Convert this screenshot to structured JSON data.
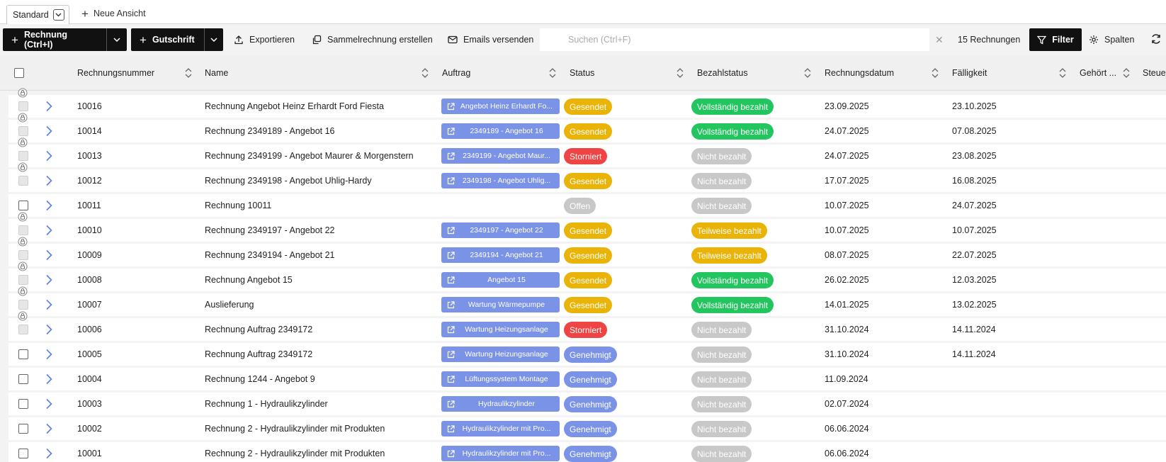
{
  "tabs": {
    "active": "Standard",
    "new_view": "Neue Ansicht"
  },
  "toolbar": {
    "invoice_button": "Rechnung (Ctrl+I)",
    "credit_button": "Gutschrift",
    "export": "Exportieren",
    "collective": "Sammelrechnung erstellen",
    "emails": "Emails versenden",
    "search_placeholder": "Suchen (Ctrl+F)",
    "search_value": "",
    "count": "15 Rechnungen",
    "filter": "Filter",
    "columns": "Spalten"
  },
  "columns": {
    "number": "Rechnungsnummer",
    "name": "Name",
    "order": "Auftrag",
    "status": "Status",
    "payment": "Bezahlstatus",
    "date": "Rechnungsdatum",
    "due": "Fälligkeit",
    "owner": "Gehört ...",
    "tax": "Steue"
  },
  "colors": {
    "sent": "#eab308",
    "cancelled": "#ef4444",
    "open": "#c8c8c8",
    "approved": "#7b93e6",
    "paid_full": "#22c55e",
    "paid_none": "#c8c8c8",
    "paid_partial": "#eab308",
    "order_link": "#7b93e6"
  },
  "rows": [
    {
      "number": "10016",
      "name": "Rechnung Angebot Heinz Erhardt Ford Fiesta",
      "order": "Angebot Heinz Erhardt Fo...",
      "status": "Gesendet",
      "status_type": "sent",
      "payment": "Vollständig bezahlt",
      "payment_type": "full",
      "date": "23.09.2025",
      "due": "23.10.2025",
      "locked": true
    },
    {
      "number": "10014",
      "name": "Rechnung 2349189 - Angebot 16",
      "order": "2349189 - Angebot 16",
      "status": "Gesendet",
      "status_type": "sent",
      "payment": "Vollständig bezahlt",
      "payment_type": "full",
      "date": "24.07.2025",
      "due": "07.08.2025",
      "locked": true
    },
    {
      "number": "10013",
      "name": "Rechnung 2349199 - Angebot Maurer & Morgenstern",
      "order": "2349199 - Angebot Maur...",
      "status": "Storniert",
      "status_type": "cancel",
      "payment": "Nicht bezahlt",
      "payment_type": "none",
      "date": "24.07.2025",
      "due": "23.08.2025",
      "locked": true
    },
    {
      "number": "10012",
      "name": "Rechnung 2349198 - Angebot Uhlig-Hardy",
      "order": "2349198 - Angebot Uhlig...",
      "status": "Gesendet",
      "status_type": "sent",
      "payment": "Nicht bezahlt",
      "payment_type": "none",
      "date": "17.07.2025",
      "due": "16.08.2025",
      "locked": true
    },
    {
      "number": "10011",
      "name": "Rechnung 10011",
      "order": "",
      "status": "Offen",
      "status_type": "open",
      "payment": "Nicht bezahlt",
      "payment_type": "none",
      "date": "10.07.2025",
      "due": "24.07.2025",
      "locked": false
    },
    {
      "number": "10010",
      "name": "Rechnung 2349197 - Angebot 22",
      "order": "2349197 - Angebot 22",
      "status": "Gesendet",
      "status_type": "sent",
      "payment": "Teilweise bezahlt",
      "payment_type": "part",
      "date": "10.07.2025",
      "due": "10.07.2025",
      "locked": true
    },
    {
      "number": "10009",
      "name": "Rechnung 2349194 - Angebot 21",
      "order": "2349194 - Angebot 21",
      "status": "Gesendet",
      "status_type": "sent",
      "payment": "Teilweise bezahlt",
      "payment_type": "part",
      "date": "08.07.2025",
      "due": "22.07.2025",
      "locked": true
    },
    {
      "number": "10008",
      "name": "Rechnung Angebot 15",
      "order": "Angebot 15",
      "status": "Gesendet",
      "status_type": "sent",
      "payment": "Vollständig bezahlt",
      "payment_type": "full",
      "date": "26.02.2025",
      "due": "12.03.2025",
      "locked": true
    },
    {
      "number": "10007",
      "name": "Auslieferung",
      "order": "Wartung Wärmepumpe",
      "status": "Gesendet",
      "status_type": "sent",
      "payment": "Vollständig bezahlt",
      "payment_type": "full",
      "date": "14.01.2025",
      "due": "13.02.2025",
      "locked": true
    },
    {
      "number": "10006",
      "name": "Rechnung Auftrag 2349172",
      "order": "Wartung Heizungsanlage",
      "status": "Storniert",
      "status_type": "cancel",
      "payment": "Nicht bezahlt",
      "payment_type": "none",
      "date": "31.10.2024",
      "due": "14.11.2024",
      "locked": true
    },
    {
      "number": "10005",
      "name": "Rechnung Auftrag 2349172",
      "order": "Wartung Heizungsanlage",
      "status": "Genehmigt",
      "status_type": "appr",
      "payment": "Nicht bezahlt",
      "payment_type": "none",
      "date": "31.10.2024",
      "due": "14.11.2024",
      "locked": false
    },
    {
      "number": "10004",
      "name": "Rechnung 1244 - Angebot 9",
      "order": "Lüftungssystem Montage",
      "status": "Genehmigt",
      "status_type": "appr",
      "payment": "Nicht bezahlt",
      "payment_type": "none",
      "date": "11.09.2024",
      "due": "",
      "locked": false
    },
    {
      "number": "10003",
      "name": "Rechnung 1 - Hydraulikzylinder",
      "order": "Hydraulikzylinder",
      "status": "Genehmigt",
      "status_type": "appr",
      "payment": "Nicht bezahlt",
      "payment_type": "none",
      "date": "02.07.2024",
      "due": "",
      "locked": false
    },
    {
      "number": "10002",
      "name": "Rechnung 2 - Hydraulikzylinder mit Produkten",
      "order": "Hydraulikzylinder mit Pro...",
      "status": "Genehmigt",
      "status_type": "appr",
      "payment": "Nicht bezahlt",
      "payment_type": "none",
      "date": "06.06.2024",
      "due": "",
      "locked": false
    },
    {
      "number": "10001",
      "name": "Rechnung 2 - Hydraulikzylinder mit Produkten",
      "order": "Hydraulikzylinder mit Pro...",
      "status": "Genehmigt",
      "status_type": "appr",
      "payment": "Nicht bezahlt",
      "payment_type": "none",
      "date": "06.06.2024",
      "due": "",
      "locked": false
    }
  ]
}
